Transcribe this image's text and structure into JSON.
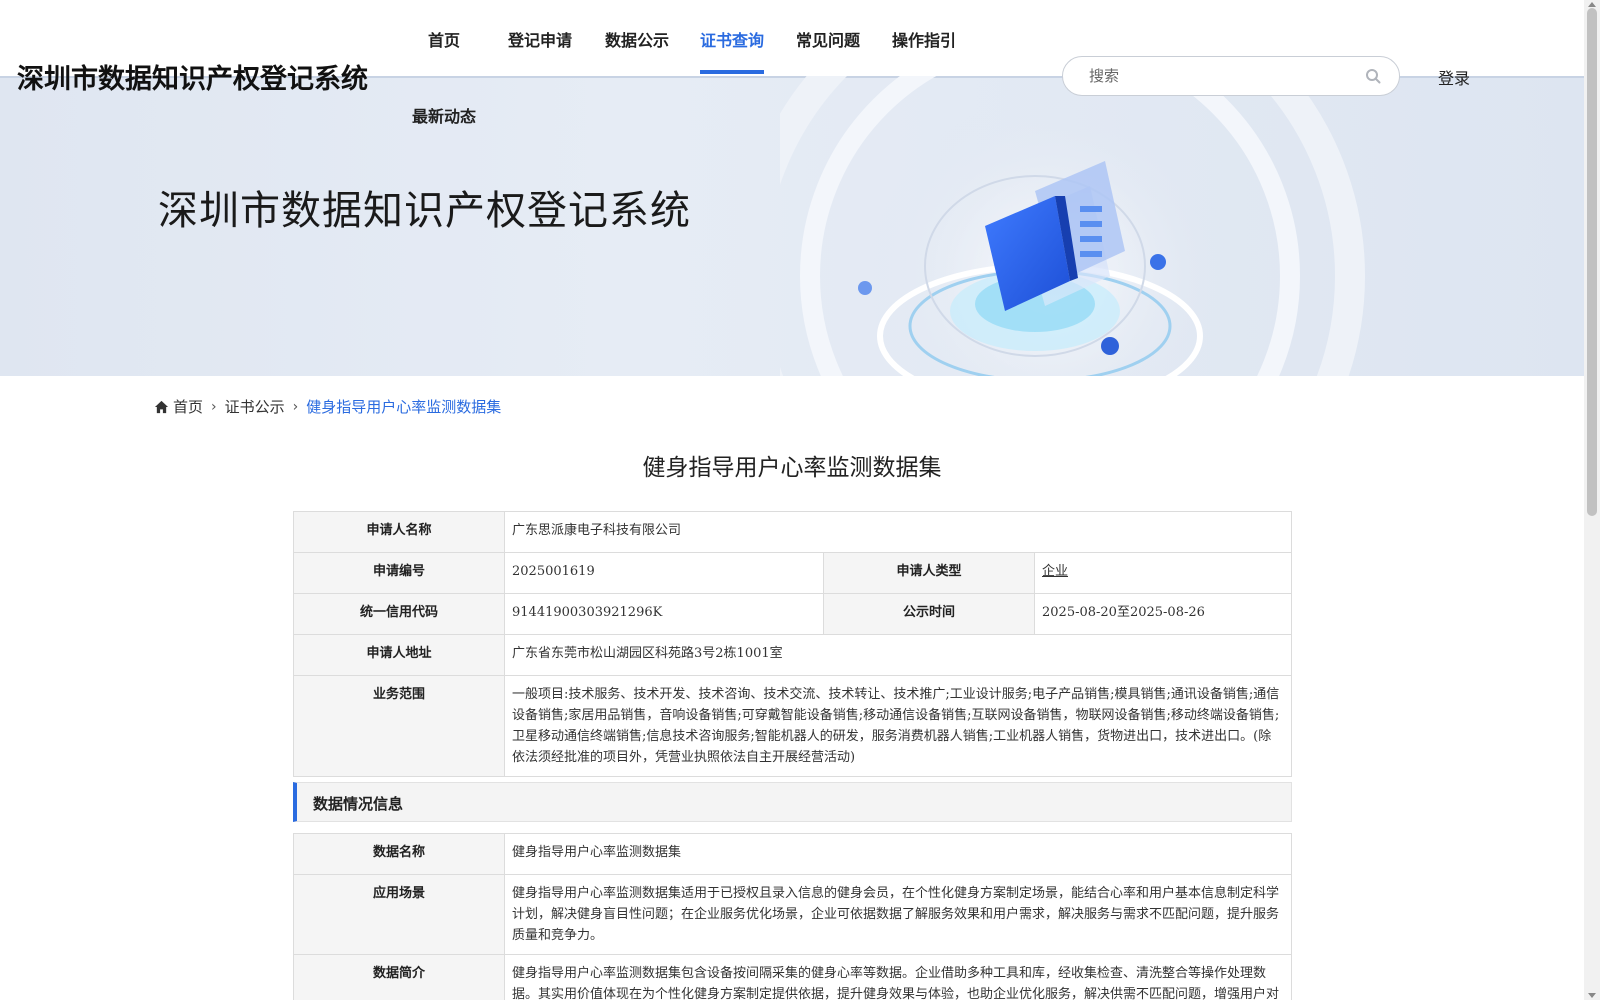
{
  "header": {
    "site_title": "深圳市数据知识产权登记系统",
    "nav": [
      {
        "label": "首页"
      },
      {
        "label": "登记申请"
      },
      {
        "label": "数据公示"
      },
      {
        "label": "证书查询",
        "active": true
      },
      {
        "label": "常见问题"
      },
      {
        "label": "操作指引"
      },
      {
        "label": "最新动态"
      }
    ],
    "search_placeholder": "搜索",
    "login_label": "登录"
  },
  "banner": {
    "title": "深圳市数据知识产权登记系统"
  },
  "breadcrumb": {
    "home": "首页",
    "parent": "证书公示",
    "current": "健身指导用户心率监测数据集"
  },
  "page_title": "健身指导用户心率监测数据集",
  "applicant": {
    "name_label": "申请人名称",
    "name": "广东思派康电子科技有限公司",
    "number_label": "申请编号",
    "number": "2025001619",
    "type_label": "申请人类型",
    "type": "企业",
    "credit_code_label": "统一信用代码",
    "credit_code": "91441900303921296K",
    "publish_time_label": "公示时间",
    "publish_time": "2025-08-20至2025-08-26",
    "address_label": "申请人地址",
    "address": "广东省东莞市松山湖园区科苑路3号2栋1001室",
    "scope_label": "业务范围",
    "scope": "一般项目:技术服务、技术开发、技术咨询、技术交流、技术转让、技术推广;工业设计服务;电子产品销售;模具销售;通讯设备销售;通信设备销售;家居用品销售，音响设备销售;可穿戴智能设备销售;移动通信设备销售;互联网设备销售，物联网设备销售;移动终端设备销售;卫星移动通信终端销售;信息技术咨询服务;智能机器人的研发，服务消费机器人销售;工业机器人销售，货物进出口，技术进出口。(除依法须经批准的项目外，凭营业执照依法自主开展经营活动)"
  },
  "data_section": {
    "heading": "数据情况信息",
    "data_name_label": "数据名称",
    "data_name": "健身指导用户心率监测数据集",
    "scenario_label": "应用场景",
    "scenario": "健身指导用户心率监测数据集适用于已授权且录入信息的健身会员，在个性化健身方案制定场景，能结合心率和用户基本信息制定科学计划，解决健身盲目性问题；在企业服务优化场景，企业可依据数据了解服务效果和用户需求，解决服务与需求不匹配问题，提升服务质量和竞争力。",
    "intro_label": "数据简介",
    "intro": "健身指导用户心率监测数据集包含设备按间隔采集的健身心率等数据。企业借助多种工具和库，经收集检查、清洗整合等操作处理数据。其实用价值体现在为个性化健身方案制定提供依据，提升健身效果与体验，也助企业优化服务，解决供需不匹配问题，增强用户对服务的信任。"
  },
  "colors": {
    "accent": "#2a6be0",
    "label_bg": "#f5f5f5",
    "border": "#dcdcdc"
  }
}
